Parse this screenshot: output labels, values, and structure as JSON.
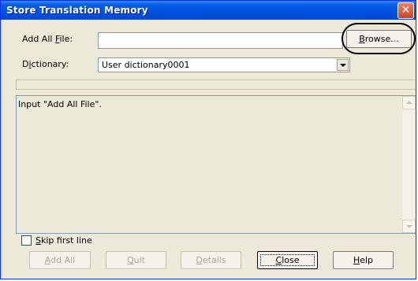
{
  "window": {
    "title": "Store Translation Memory",
    "close_icon": "close-icon"
  },
  "form": {
    "add_all_file_label_pre": "Add All ",
    "add_all_file_label_accel": "F",
    "add_all_file_label_post": "ile:",
    "add_all_file_value": "",
    "dictionary_label_pre": "D",
    "dictionary_label_accel": "i",
    "dictionary_label_post": "ctionary:",
    "dictionary_value": "User dictionary0001"
  },
  "buttons": {
    "browse_accel": "B",
    "browse_rest": "rowse...",
    "add_all_pre": "",
    "add_all_accel": "A",
    "add_all_post": "dd All",
    "quit_accel": "Q",
    "quit_post": "uit",
    "details_accel": "D",
    "details_post": "etails",
    "close_accel": "C",
    "close_post": "lose",
    "help_accel": "H",
    "help_post": "elp"
  },
  "log": {
    "message": "Input \"Add All File\"."
  },
  "options": {
    "skip_first_line_accel": "S",
    "skip_first_line_post": "kip first line",
    "skip_first_line_checked": false
  },
  "progress": {
    "value": 0
  },
  "colors": {
    "titlebar": "#0054e3",
    "dialog_bg": "#ece9d8",
    "input_border": "#7f9db9",
    "disabled_text": "#aca899"
  }
}
